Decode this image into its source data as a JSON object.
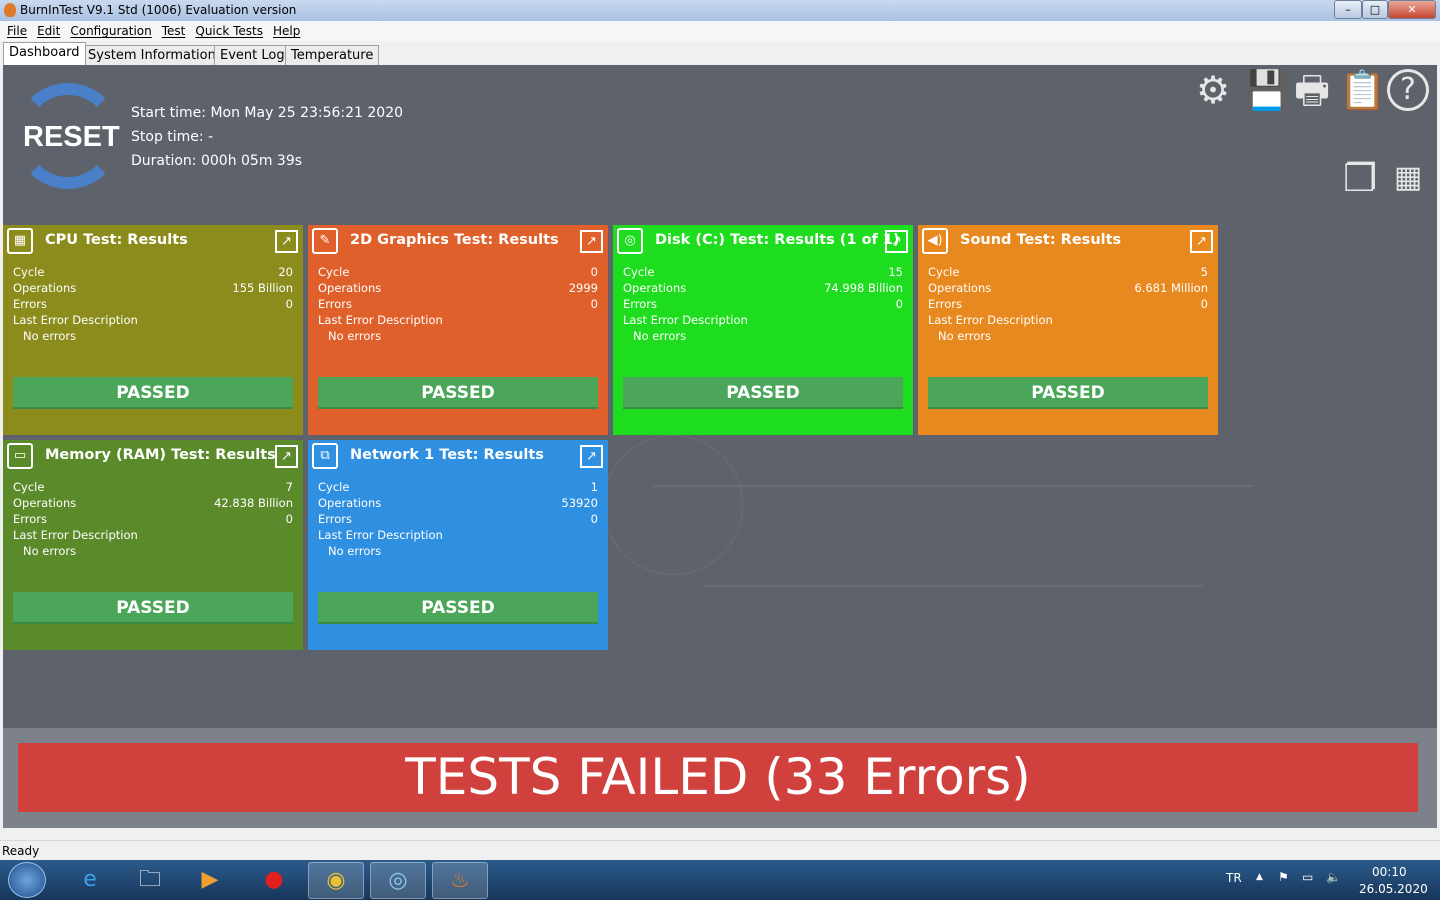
{
  "window": {
    "title": "BurnInTest V9.1 Std (1006) Evaluation version",
    "minimize": "–",
    "maximize": "□",
    "close": "✕"
  },
  "menu": [
    "File",
    "Edit",
    "Configuration",
    "Test",
    "Quick Tests",
    "Help"
  ],
  "tabs": [
    "Dashboard",
    "System Information",
    "Event Log",
    "Temperature"
  ],
  "dashboard": {
    "reset_label": "RESET",
    "start_time": "Start time: Mon May 25 23:56:21 2020",
    "stop_time": "Stop time: -",
    "duration": "Duration: 000h 05m 39s"
  },
  "labels": {
    "cycle": "Cycle",
    "operations": "Operations",
    "errors": "Errors",
    "last_error": "Last Error Description"
  },
  "cards": [
    {
      "title": "CPU Test: Results",
      "color": "#8b8c1c",
      "icon": "cpu-icon",
      "glyph": "▦",
      "cycle": "20",
      "operations": "155 Billion",
      "errors": "0",
      "last_error": "No errors",
      "status": "PASSED"
    },
    {
      "title": "2D Graphics Test: Results",
      "color": "#e0602b",
      "icon": "paintbrush-icon",
      "glyph": "✎",
      "cycle": "0",
      "operations": "2999",
      "errors": "0",
      "last_error": "No errors",
      "status": "PASSED"
    },
    {
      "title": "Disk (C:) Test: Results (1 of 1)",
      "color": "#1edc1e",
      "icon": "disk-icon",
      "glyph": "◎",
      "cycle": "15",
      "operations": "74.998 Billion",
      "errors": "0",
      "last_error": "No errors",
      "status": "PASSED"
    },
    {
      "title": "Sound Test: Results",
      "color": "#e8891f",
      "icon": "speaker-icon",
      "glyph": "◀)",
      "cycle": "5",
      "operations": "6.681 Million",
      "errors": "0",
      "last_error": "No errors",
      "status": "PASSED"
    },
    {
      "title": "Memory (RAM) Test: Results",
      "color": "#5b8a2b",
      "icon": "memory-icon",
      "glyph": "▭",
      "cycle": "7",
      "operations": "42.838 Billion",
      "errors": "0",
      "last_error": "No errors",
      "status": "PASSED"
    },
    {
      "title": "Network 1 Test: Results",
      "color": "#2f8fe0",
      "icon": "network-icon",
      "glyph": "⧉",
      "cycle": "1",
      "operations": "53920",
      "errors": "0",
      "last_error": "No errors",
      "status": "PASSED"
    }
  ],
  "banner": "TESTS FAILED (33 Errors)",
  "status_bar": "Ready",
  "tray": {
    "lang": "TR",
    "time": "00:10",
    "date": "26.05.2020"
  }
}
